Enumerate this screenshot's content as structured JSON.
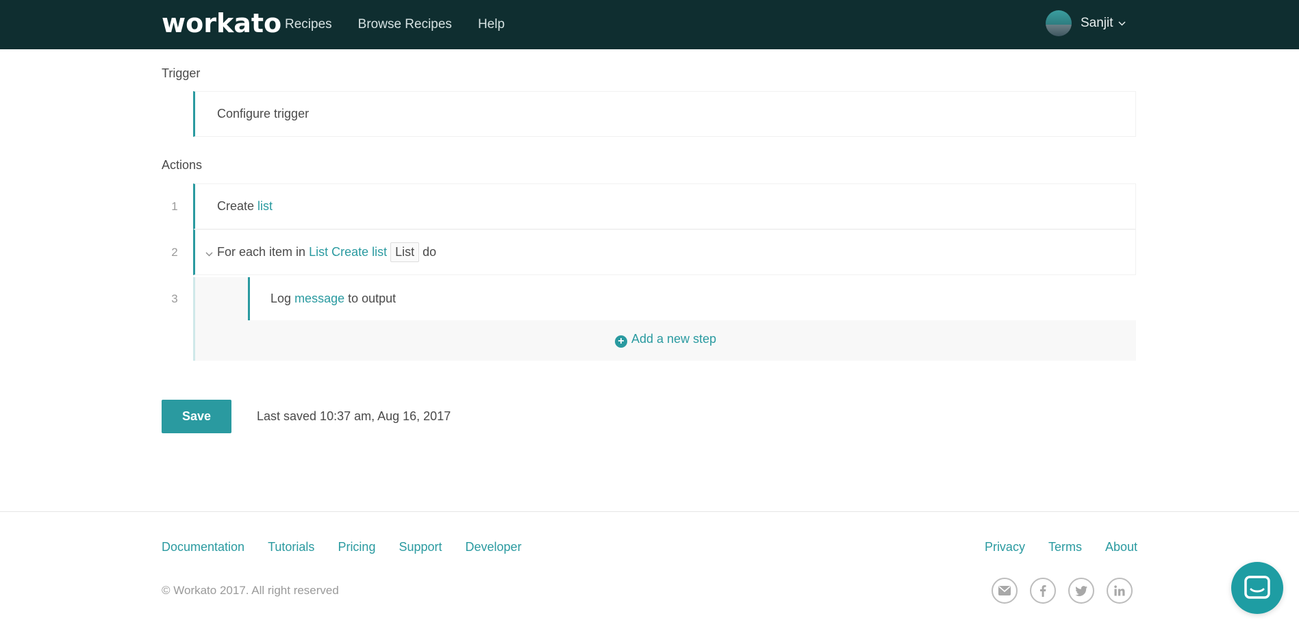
{
  "header": {
    "logo": "workato",
    "nav": [
      "Recipes",
      "Browse Recipes",
      "Help"
    ],
    "user_name": "Sanjit"
  },
  "trigger": {
    "label": "Trigger",
    "card_text": "Configure trigger"
  },
  "actions": {
    "label": "Actions",
    "steps": [
      {
        "num": "1",
        "text": "Create",
        "link": "list"
      },
      {
        "num": "2",
        "text": "For each item in",
        "link": "List Create list",
        "pill": "List",
        "suffix": "do"
      },
      {
        "num": "3",
        "text": "Log",
        "link": "message",
        "suffix": "to output"
      }
    ],
    "add_step": "Add a new step"
  },
  "save": {
    "button": "Save",
    "last_saved": "Last saved 10:37 am, Aug 16, 2017"
  },
  "footer": {
    "links_left": [
      "Documentation",
      "Tutorials",
      "Pricing",
      "Support",
      "Developer"
    ],
    "links_right": [
      "Privacy",
      "Terms",
      "About"
    ],
    "copyright": "© Workato 2017. All right reserved",
    "socials": [
      "email-icon",
      "facebook-icon",
      "twitter-icon",
      "linkedin-icon"
    ]
  },
  "colors": {
    "header_bg": "#0f2e30",
    "accent": "#2a9aa0"
  }
}
